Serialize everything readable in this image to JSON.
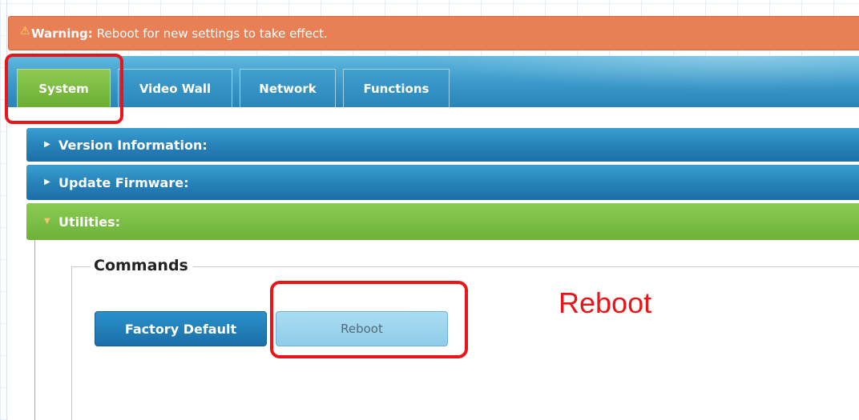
{
  "warning": {
    "icon": "warning-triangle-icon",
    "label": "Warning:",
    "message": "Reboot for new settings to take effect.",
    "background_color": "#e87f55"
  },
  "tabs": [
    {
      "label": "System",
      "active": true
    },
    {
      "label": "Video Wall",
      "active": false
    },
    {
      "label": "Network",
      "active": false
    },
    {
      "label": "Functions",
      "active": false
    }
  ],
  "accordion": {
    "version": {
      "label": "Version Information:",
      "expanded": false,
      "color": "#2780b8"
    },
    "firmware": {
      "label": "Update Firmware:",
      "expanded": false,
      "color": "#2780b8"
    },
    "utilities": {
      "label": "Utilities:",
      "expanded": true,
      "color": "#6eb239"
    }
  },
  "commands": {
    "legend": "Commands",
    "factory_default_label": "Factory Default",
    "reboot_label": "Reboot"
  },
  "annotations": {
    "reboot_callout": "Reboot",
    "highlight_color": "#e8151b"
  }
}
